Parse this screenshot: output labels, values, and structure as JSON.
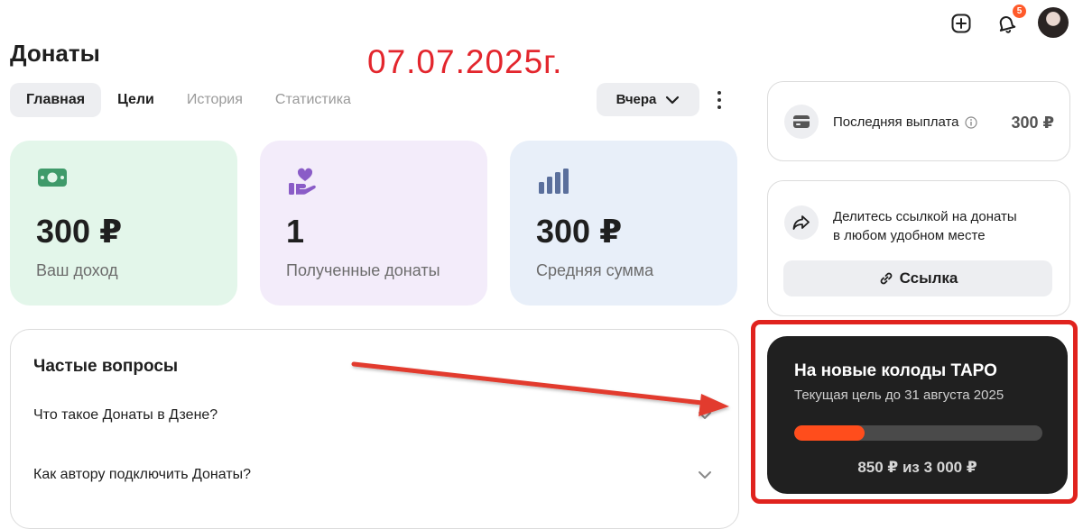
{
  "header": {
    "notifications_count": "5",
    "icons": [
      "add-icon",
      "bell-icon",
      "avatar"
    ]
  },
  "page": {
    "title": "Донаты",
    "date_annotation": "07.07.2025г."
  },
  "tabs": [
    {
      "label": "Главная",
      "state": "active"
    },
    {
      "label": "Цели",
      "state": "normal"
    },
    {
      "label": "История",
      "state": "muted"
    },
    {
      "label": "Статистика",
      "state": "muted"
    }
  ],
  "period": {
    "label": "Вчера"
  },
  "stats": [
    {
      "value": "300 ₽",
      "label": "Ваш доход",
      "icon": "money-icon",
      "bg": "#e3f6ea",
      "accent": "#3f9a6a"
    },
    {
      "value": "1",
      "label": "Полученные донаты",
      "icon": "heart-hand-icon",
      "bg": "#f3ecfa",
      "accent": "#8a5cc7"
    },
    {
      "value": "300 ₽",
      "label": "Средняя сумма",
      "icon": "bar-chart-icon",
      "bg": "#e8eff9",
      "accent": "#5a6f9c"
    }
  ],
  "faq": {
    "title": "Частые вопросы",
    "items": [
      {
        "question": "Что такое Донаты в Дзене?"
      },
      {
        "question": "Как автору подключить Донаты?"
      }
    ]
  },
  "payout": {
    "label": "Последняя выплата",
    "value": "300 ₽"
  },
  "share": {
    "text_line1": "Делитесь ссылкой на донаты",
    "text_line2": "в любом удобном месте",
    "button_label": "Ссылка"
  },
  "goal": {
    "title": "На новые колоды ТАРО",
    "subtitle": "Текущая цель до 31 августа 2025",
    "progress": 0.283,
    "amount": "850 ₽ из 3 000 ₽"
  },
  "colors": {
    "annotation_red": "#e3262d",
    "goal_bar": "#ff4d1c",
    "goal_bg": "#202020"
  }
}
